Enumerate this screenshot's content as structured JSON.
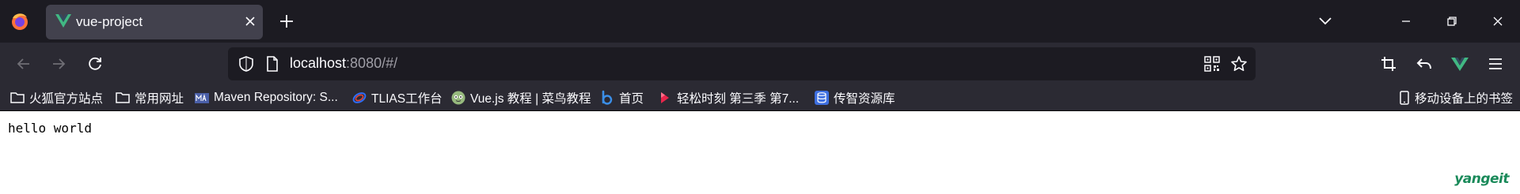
{
  "browser": {
    "tab": {
      "title": "vue-project"
    }
  },
  "urlbar": {
    "host": "localhost",
    "path": ":8080/#/"
  },
  "bookmarks": {
    "items": [
      {
        "label": "火狐官方站点",
        "icon": "folder-icon"
      },
      {
        "label": "常用网址",
        "icon": "folder-icon"
      },
      {
        "label": "Maven Repository: S...",
        "icon": "maven-icon"
      },
      {
        "label": "TLIAS工作台",
        "icon": "tlias-icon"
      },
      {
        "label": "Vue.js 教程 | 菜鸟教程",
        "icon": "runoob-icon"
      },
      {
        "label": "首页",
        "icon": "bilibili-icon"
      },
      {
        "label": "轻松时刻 第三季 第7...",
        "icon": "video-icon"
      },
      {
        "label": "传智资源库",
        "icon": "database-icon"
      }
    ],
    "mobile": {
      "label": "移动设备上的书签",
      "icon": "mobile-icon"
    }
  },
  "page": {
    "text": "hello world",
    "watermark": "yangeit"
  },
  "colors": {
    "tabbar_bg": "#1c1b22",
    "toolbar_bg": "#2b2a33",
    "vue_green": "#41b883",
    "vue_dark": "#34495e"
  }
}
